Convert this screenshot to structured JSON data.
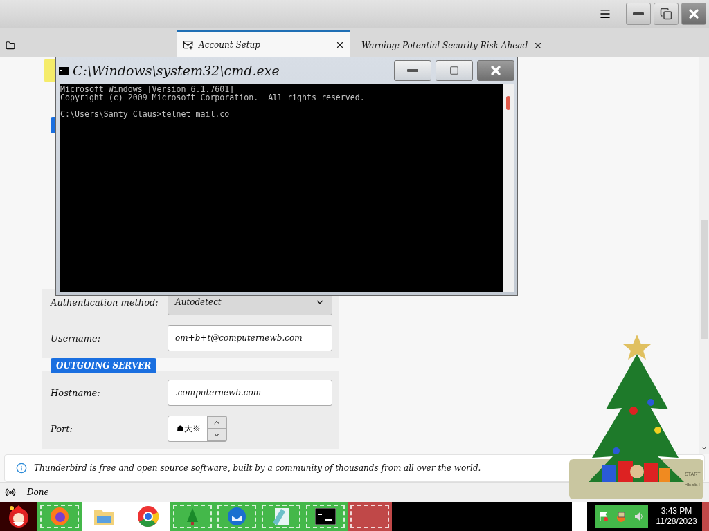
{
  "tabs": [
    {
      "kind": "folder",
      "selected": false
    },
    {
      "kind": "mail",
      "label": "Account Setup",
      "selected": true
    },
    {
      "kind": "warning",
      "label": "Warning: Potential Security Risk Ahead",
      "selected": false
    }
  ],
  "console_window": {
    "title": "C:\\Windows\\system32\\cmd.exe",
    "blocks": [
      [
        "Microsoft Windows [Version 6.1.7601]",
        "Copyright (c) 2009 Microsoft Corporation.  All rights reserved."
      ],
      [
        "C:\\Users\\Santy Claus>telnet mail.co"
      ]
    ]
  },
  "incoming_fields": [
    {
      "kind": "select",
      "label": "Authentication method:",
      "value": "Autodetect"
    },
    {
      "kind": "text",
      "label": "Username:",
      "value": "om+b+t@computernewb.com"
    }
  ],
  "outgoing": {
    "heading": "OUTGOING SERVER",
    "fields": [
      {
        "kind": "text",
        "label": "Hostname:",
        "value": ".computernewb.com"
      },
      {
        "kind": "spinner",
        "label": "Port:",
        "value": "☗大※"
      }
    ]
  },
  "info_bar": {
    "text": "Thunderbird is free and open source software, built by a community of thousands from all over the world."
  },
  "status_bar": {
    "text": "Done"
  },
  "timer_gadget": {
    "buttons": [
      "START",
      "RESET"
    ]
  },
  "clock": {
    "time": "3:43 PM",
    "date": "11/28/2023"
  }
}
